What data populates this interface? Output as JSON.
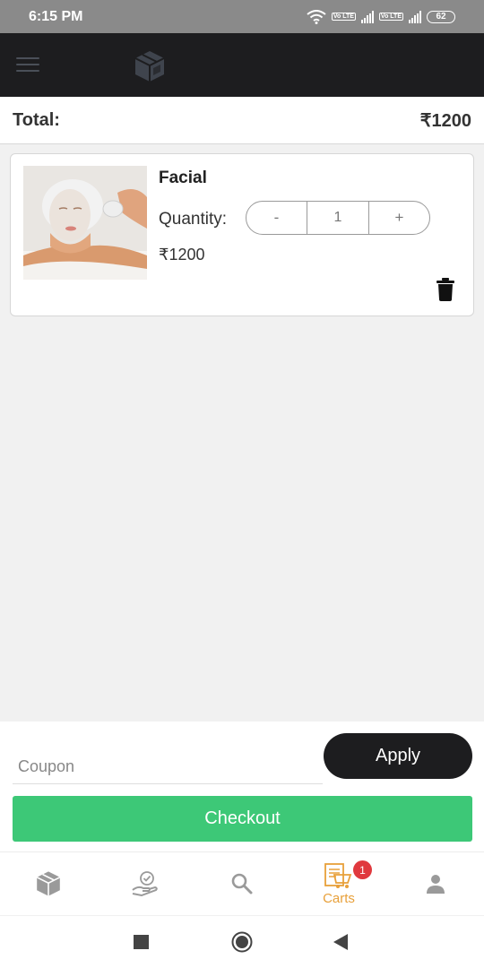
{
  "status_bar": {
    "time": "6:15 PM",
    "battery": "62",
    "volte_label": "Vo LTE"
  },
  "header": {
    "menu_icon": "hamburger-menu-icon",
    "logo_icon": "cube-logo-icon"
  },
  "cart": {
    "total_label": "Total:",
    "total_amount": "₹1200",
    "items": [
      {
        "name": "Facial",
        "quantity_label": "Quantity:",
        "decrement_label": "-",
        "quantity": "1",
        "increment_label": "+",
        "price": "₹1200",
        "image_icon": "facial-treatment-photo",
        "delete_icon": "trash-icon"
      }
    ]
  },
  "coupon": {
    "placeholder": "Coupon",
    "apply_label": "Apply"
  },
  "checkout": {
    "label": "Checkout"
  },
  "bottom_nav": {
    "items": [
      {
        "icon": "cube-home-icon"
      },
      {
        "icon": "hand-check-icon"
      },
      {
        "icon": "search-icon"
      },
      {
        "icon": "cart-icon",
        "label": "Carts",
        "badge": "1",
        "active": true
      },
      {
        "icon": "user-icon"
      }
    ]
  },
  "colors": {
    "header_bg": "#1d1d1f",
    "checkout_green": "#3dc877",
    "active_nav": "#e8a03a",
    "badge_red": "#e0393e"
  }
}
